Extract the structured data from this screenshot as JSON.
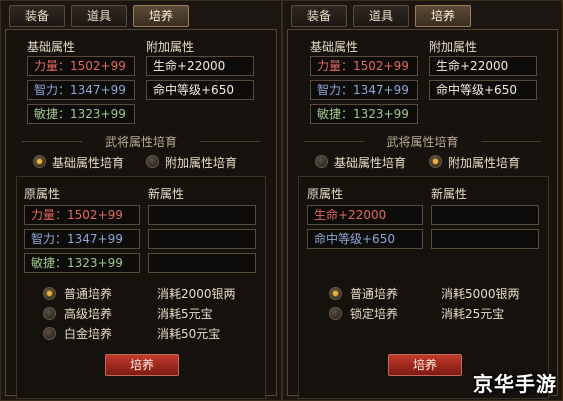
{
  "left": {
    "tabs": [
      "装备",
      "道具",
      "培养"
    ],
    "base_header": "基础属性",
    "extra_header": "附加属性",
    "base_stats": [
      {
        "label": "力量",
        "value": "：1502+99"
      },
      {
        "label": "智力",
        "value": "：1347+99"
      },
      {
        "label": "敏捷",
        "value": "：1323+99"
      }
    ],
    "extra_stats": [
      "生命+22000",
      "命中等级+650"
    ],
    "section_title": "武将属性培育",
    "mode_options": [
      "基础属性培育",
      "附加属性培育"
    ],
    "mode_selected": 0,
    "orig_header": "原属性",
    "new_header": "新属性",
    "orig_stats": [
      {
        "label": "力量",
        "value": "：1502+99"
      },
      {
        "label": "智力",
        "value": "：1347+99"
      },
      {
        "label": "敏捷",
        "value": "：1323+99"
      }
    ],
    "train_options": [
      {
        "name": "普通培养",
        "cost": "消耗2000银两"
      },
      {
        "name": "高级培养",
        "cost": "消耗5元宝"
      },
      {
        "name": "白金培养",
        "cost": "消耗50元宝"
      }
    ],
    "train_selected": 0,
    "button": "培养"
  },
  "right": {
    "tabs": [
      "装备",
      "道具",
      "培养"
    ],
    "base_header": "基础属性",
    "extra_header": "附加属性",
    "base_stats": [
      {
        "label": "力量",
        "value": "：1502+99"
      },
      {
        "label": "智力",
        "value": "：1347+99"
      },
      {
        "label": "敏捷",
        "value": "：1323+99"
      }
    ],
    "extra_stats": [
      "生命+22000",
      "命中等级+650"
    ],
    "section_title": "武将属性培育",
    "mode_options": [
      "基础属性培育",
      "附加属性培育"
    ],
    "mode_selected": 1,
    "orig_header": "原属性",
    "new_header": "新属性",
    "orig_stats": [
      "生命+22000",
      "命中等级+650"
    ],
    "train_options": [
      {
        "name": "普通培养",
        "cost": "消耗5000银两"
      },
      {
        "name": "锁定培养",
        "cost": "消耗25元宝"
      }
    ],
    "train_selected": 0,
    "button": "培养"
  },
  "watermark": "京华手游"
}
